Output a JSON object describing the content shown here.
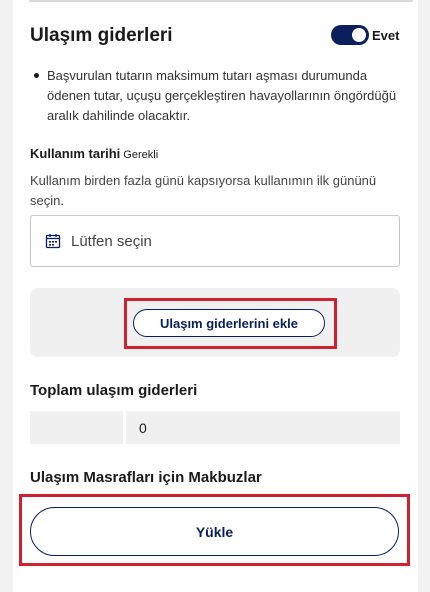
{
  "section": {
    "title": "Ulaşım giderleri",
    "toggle": {
      "state": "on",
      "label": "Evet"
    }
  },
  "info_bullet": "Başvurulan tutarın maksimum tutarı aşması durumunda ödenen tutar, uçuşu gerçekleştiren havayollarının öngördüğü aralık dahilinde olacaktır.",
  "usage_date": {
    "label": "Kullanım tarihi",
    "required_text": "Gerekli",
    "help": "Kullanım birden fazla günü kapsıyorsa kullanımın ilk gününü seçin.",
    "placeholder": "Lütfen seçin",
    "icon": "calendar-icon"
  },
  "add_expenses_button": "Ulaşım giderlerini ekle",
  "total": {
    "label": "Toplam ulaşım giderleri",
    "value": "0"
  },
  "receipts": {
    "label": "Ulaşım Masrafları için Makbuzlar",
    "upload_button": "Yükle"
  },
  "colors": {
    "accent": "#0b1f5c",
    "highlight": "#d0212e",
    "panel_bg": "#f0f0f0"
  }
}
